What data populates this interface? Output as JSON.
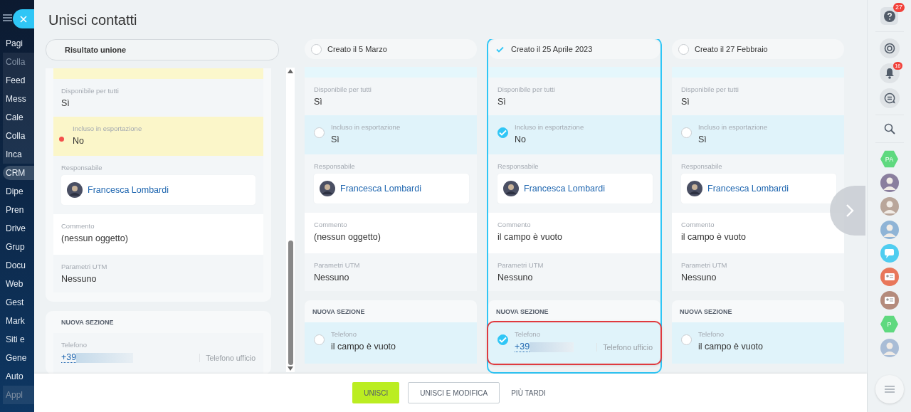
{
  "sidebar": {
    "items": [
      {
        "label": "Pagi",
        "kind": "link"
      },
      {
        "label": "Colla",
        "kind": "group-title"
      },
      {
        "label": "Feed",
        "kind": "group"
      },
      {
        "label": "Mess",
        "kind": "group"
      },
      {
        "label": "Cale",
        "kind": "group"
      },
      {
        "label": "Colla",
        "kind": "group"
      },
      {
        "label": "Inca",
        "kind": "group"
      },
      {
        "label": "CRM",
        "kind": "tag"
      },
      {
        "label": "Dipe",
        "kind": "link"
      },
      {
        "label": "Pren",
        "kind": "link"
      },
      {
        "label": "Drive",
        "kind": "link"
      },
      {
        "label": "Grup",
        "kind": "link"
      },
      {
        "label": "Docu",
        "kind": "link"
      },
      {
        "label": "Web",
        "kind": "link"
      },
      {
        "label": "Gest",
        "kind": "link"
      },
      {
        "label": "Mark",
        "kind": "link"
      },
      {
        "label": "Siti e",
        "kind": "link"
      },
      {
        "label": "Gene",
        "kind": "link"
      },
      {
        "label": "Auto",
        "kind": "link"
      },
      {
        "label": "Appl",
        "kind": "group-title"
      }
    ]
  },
  "title": "Unisci contatti",
  "result": {
    "header": "Risultato unione",
    "fields": [
      {
        "kind": "text",
        "label": "Disponibile per tutti",
        "value": "Sì"
      },
      {
        "kind": "choice",
        "label": "Incluso in esportazione",
        "value": "No",
        "conflict": true
      },
      {
        "kind": "user",
        "label": "Responsabile",
        "value": "Francesca Lombardi"
      },
      {
        "kind": "text",
        "label": "Commento",
        "value": "(nessun oggetto)"
      },
      {
        "kind": "text",
        "label": "Parametri UTM",
        "value": "Nessuno"
      }
    ],
    "section": {
      "title": "NUOVA SEZIONE",
      "fields": [
        {
          "kind": "phone",
          "label": "Telefono",
          "value": "+39",
          "type": "Telefono ufficio"
        }
      ]
    }
  },
  "candidates": [
    {
      "header": "Creato il 5 Marzo",
      "selected": false,
      "fields": [
        {
          "kind": "text",
          "label": "Disponibile per tutti",
          "value": "Sì"
        },
        {
          "kind": "choice",
          "label": "Incluso in esportazione",
          "value": "Sì",
          "checked": false
        },
        {
          "kind": "user",
          "label": "Responsabile",
          "value": "Francesca Lombardi"
        },
        {
          "kind": "text",
          "label": "Commento",
          "value": "(nessun oggetto)"
        },
        {
          "kind": "text",
          "label": "Parametri UTM",
          "value": "Nessuno"
        }
      ],
      "section": {
        "title": "NUOVA SEZIONE",
        "fields": [
          {
            "kind": "choice",
            "label": "Telefono",
            "value": "il campo è vuoto",
            "checked": false,
            "highlighted": false
          }
        ]
      }
    },
    {
      "header": "Creato il 25 Aprile 2023",
      "selected": true,
      "fields": [
        {
          "kind": "text",
          "label": "Disponibile per tutti",
          "value": "Sì"
        },
        {
          "kind": "choice",
          "label": "Incluso in esportazione",
          "value": "No",
          "checked": true
        },
        {
          "kind": "user",
          "label": "Responsabile",
          "value": "Francesca Lombardi"
        },
        {
          "kind": "text",
          "label": "Commento",
          "value": "il campo è vuoto"
        },
        {
          "kind": "text",
          "label": "Parametri UTM",
          "value": "Nessuno"
        }
      ],
      "section": {
        "title": "NUOVA SEZIONE",
        "fields": [
          {
            "kind": "phone",
            "label": "Telefono",
            "value": "+39",
            "type": "Telefono ufficio",
            "checked": true,
            "highlighted": true
          }
        ]
      }
    },
    {
      "header": "Creato il 27 Febbraio",
      "selected": false,
      "fields": [
        {
          "kind": "text",
          "label": "Disponibile per tutti",
          "value": "Sì"
        },
        {
          "kind": "choice",
          "label": "Incluso in esportazione",
          "value": "Sì",
          "checked": false
        },
        {
          "kind": "user",
          "label": "Responsabile",
          "value": "Francesca Lombardi"
        },
        {
          "kind": "text",
          "label": "Commento",
          "value": "il campo è vuoto"
        },
        {
          "kind": "text",
          "label": "Parametri UTM",
          "value": "Nessuno"
        }
      ],
      "section": {
        "title": "NUOVA SEZIONE",
        "fields": [
          {
            "kind": "choice",
            "label": "Telefono",
            "value": "il campo è vuoto",
            "checked": false,
            "highlighted": false
          }
        ]
      }
    }
  ],
  "buttons": [
    {
      "label": "UNISCI",
      "kind": "primary"
    },
    {
      "label": "UNISCI E MODIFICA",
      "kind": "secondary"
    },
    {
      "label": "PIÙ TARDI",
      "kind": "link"
    }
  ],
  "right_bar": {
    "help_badge": "27",
    "tools": [
      {
        "kind": "radar"
      },
      {
        "kind": "bell",
        "badge": "16"
      },
      {
        "kind": "chat"
      }
    ],
    "contacts": [
      {
        "kind": "group",
        "label": "PA",
        "color": "#5fd97f"
      },
      {
        "kind": "avatar",
        "color": "#8a7f9e"
      },
      {
        "kind": "avatar",
        "color": "#b9a69a"
      },
      {
        "kind": "avatar",
        "color": "#8fb4d6"
      },
      {
        "kind": "chat",
        "color": "#4fcdf0"
      },
      {
        "kind": "card",
        "color": "#e8775a"
      },
      {
        "kind": "card",
        "color": "#b48b7c"
      },
      {
        "kind": "group",
        "label": "P",
        "color": "#5fd97f"
      },
      {
        "kind": "avatar",
        "color": "#a9bdd6"
      }
    ]
  }
}
